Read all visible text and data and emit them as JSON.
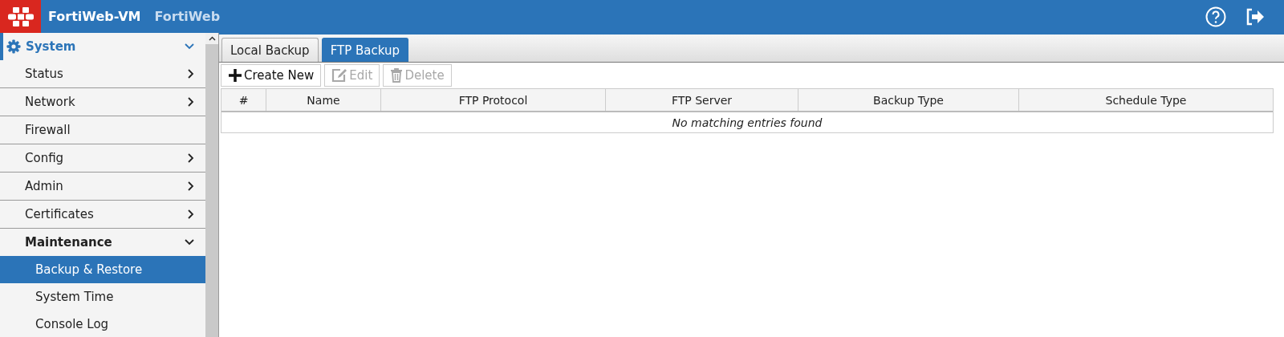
{
  "header": {
    "product": "FortiWeb-VM",
    "hostname": "FortiWeb"
  },
  "sidebar": {
    "items": [
      {
        "label": "System",
        "kind": "folder",
        "expanded": true,
        "children": [
          {
            "label": "Status",
            "kind": "folder",
            "expanded": false
          },
          {
            "label": "Network",
            "kind": "folder",
            "expanded": false
          },
          {
            "label": "Firewall",
            "kind": "page",
            "selected": false
          },
          {
            "label": "Config",
            "kind": "folder",
            "expanded": false
          },
          {
            "label": "Admin",
            "kind": "folder",
            "expanded": false
          },
          {
            "label": "Certificates",
            "kind": "folder",
            "expanded": false
          },
          {
            "label": "Maintenance",
            "kind": "folder",
            "expanded": true,
            "children": [
              {
                "label": "Backup & Restore",
                "kind": "page",
                "selected": true
              },
              {
                "label": "System Time",
                "kind": "page",
                "selected": false
              },
              {
                "label": "Console Log",
                "kind": "page",
                "selected": false
              }
            ]
          }
        ]
      }
    ]
  },
  "tabs": [
    {
      "label": "Local Backup",
      "selected": false
    },
    {
      "label": "FTP Backup",
      "selected": true
    }
  ],
  "toolbar": [
    {
      "label": "Create New",
      "kind": "create",
      "disabled": false
    },
    {
      "label": "Edit",
      "kind": "edit",
      "disabled": true
    },
    {
      "label": "Delete",
      "kind": "delete",
      "disabled": true
    }
  ],
  "table": {
    "columns": [
      "#",
      "Name",
      "FTP Protocol",
      "FTP Server",
      "Backup Type",
      "Schedule Type"
    ],
    "empty_message": "No matching entries found"
  }
}
